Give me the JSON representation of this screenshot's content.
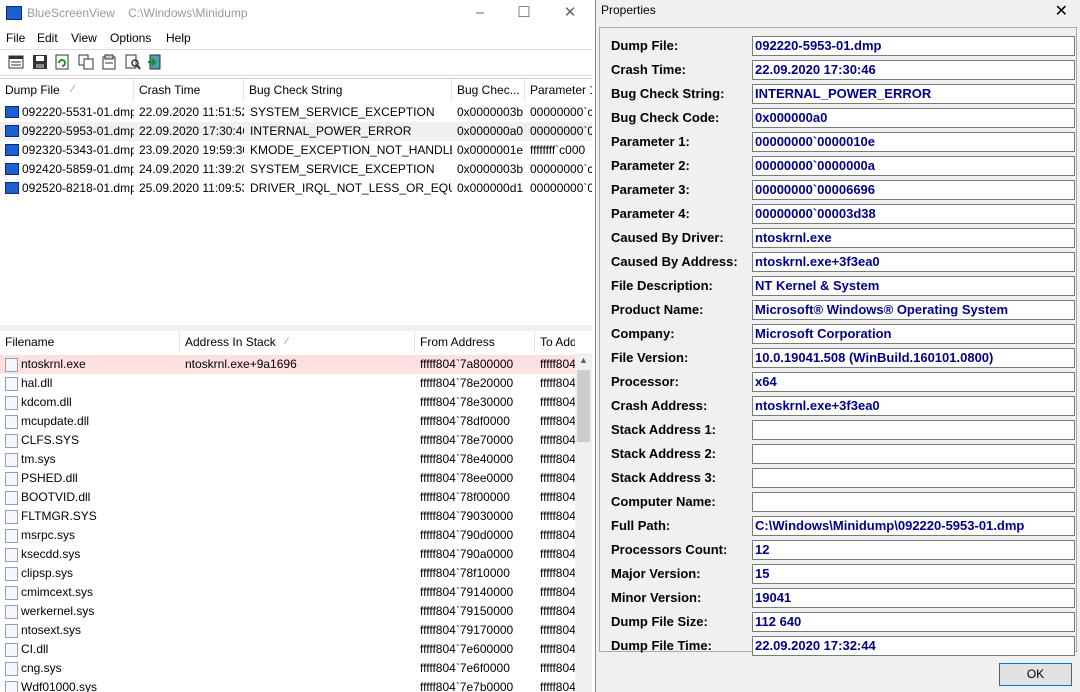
{
  "main_window": {
    "title": "BlueScreenView    C:\\Windows\\Minidump",
    "menu": [
      "File",
      "Edit",
      "View",
      "Options",
      "Help"
    ]
  },
  "dump_list": {
    "columns": [
      "Dump File",
      "Crash Time",
      "Bug Check String",
      "Bug Chec...",
      "Parameter 1"
    ],
    "rows": [
      [
        "092220-5531-01.dmp",
        "22.09.2020 11:51:52",
        "SYSTEM_SERVICE_EXCEPTION",
        "0x0000003b",
        "00000000`c0"
      ],
      [
        "092220-5953-01.dmp",
        "22.09.2020 17:30:46",
        "INTERNAL_POWER_ERROR",
        "0x000000a0",
        "00000000`00"
      ],
      [
        "092320-5343-01.dmp",
        "23.09.2020 19:59:30",
        "KMODE_EXCEPTION_NOT_HANDLED",
        "0x0000001e",
        "ffffffff`c000"
      ],
      [
        "092420-5859-01.dmp",
        "24.09.2020 11:39:20",
        "SYSTEM_SERVICE_EXCEPTION",
        "0x0000003b",
        "00000000`c0"
      ],
      [
        "092520-8218-01.dmp",
        "25.09.2020 11:09:53",
        "DRIVER_IRQL_NOT_LESS_OR_EQUAL",
        "0x000000d1",
        "00000000`00"
      ]
    ]
  },
  "driver_list": {
    "columns": [
      "Filename",
      "Address In Stack",
      "From Address",
      "To Add"
    ],
    "rows": [
      [
        "ntoskrnl.exe",
        "ntoskrnl.exe+9a1696",
        "fffff804`7a800000",
        "fffff804"
      ],
      [
        "hal.dll",
        "",
        "fffff804`78e20000",
        "fffff804"
      ],
      [
        "kdcom.dll",
        "",
        "fffff804`78e30000",
        "fffff804"
      ],
      [
        "mcupdate.dll",
        "",
        "fffff804`78df0000",
        "fffff804"
      ],
      [
        "CLFS.SYS",
        "",
        "fffff804`78e70000",
        "fffff804"
      ],
      [
        "tm.sys",
        "",
        "fffff804`78e40000",
        "fffff804"
      ],
      [
        "PSHED.dll",
        "",
        "fffff804`78ee0000",
        "fffff804"
      ],
      [
        "BOOTVID.dll",
        "",
        "fffff804`78f00000",
        "fffff804"
      ],
      [
        "FLTMGR.SYS",
        "",
        "fffff804`79030000",
        "fffff804"
      ],
      [
        "msrpc.sys",
        "",
        "fffff804`790d0000",
        "fffff804"
      ],
      [
        "ksecdd.sys",
        "",
        "fffff804`790a0000",
        "fffff804"
      ],
      [
        "clipsp.sys",
        "",
        "fffff804`78f10000",
        "fffff804"
      ],
      [
        "cmimcext.sys",
        "",
        "fffff804`79140000",
        "fffff804"
      ],
      [
        "werkernel.sys",
        "",
        "fffff804`79150000",
        "fffff804"
      ],
      [
        "ntosext.sys",
        "",
        "fffff804`79170000",
        "fffff804"
      ],
      [
        "CI.dll",
        "",
        "fffff804`7e600000",
        "fffff804"
      ],
      [
        "cng.sys",
        "",
        "fffff804`7e6f0000",
        "fffff804"
      ],
      [
        "Wdf01000.sys",
        "",
        "fffff804`7e7b0000",
        "fffff804"
      ]
    ]
  },
  "properties": {
    "title": "Properties",
    "ok_label": "OK",
    "fields": [
      {
        "label": "Dump File:",
        "value": "092220-5953-01.dmp"
      },
      {
        "label": "Crash Time:",
        "value": "22.09.2020 17:30:46"
      },
      {
        "label": "Bug Check String:",
        "value": "INTERNAL_POWER_ERROR"
      },
      {
        "label": "Bug Check Code:",
        "value": "0x000000a0"
      },
      {
        "label": "Parameter 1:",
        "value": "00000000`0000010e"
      },
      {
        "label": "Parameter 2:",
        "value": "00000000`0000000a"
      },
      {
        "label": "Parameter 3:",
        "value": "00000000`00006696"
      },
      {
        "label": "Parameter 4:",
        "value": "00000000`00003d38"
      },
      {
        "label": "Caused By Driver:",
        "value": "ntoskrnl.exe"
      },
      {
        "label": "Caused By Address:",
        "value": "ntoskrnl.exe+3f3ea0"
      },
      {
        "label": "File Description:",
        "value": "NT Kernel & System"
      },
      {
        "label": "Product Name:",
        "value": "Microsoft® Windows® Operating System"
      },
      {
        "label": "Company:",
        "value": "Microsoft Corporation"
      },
      {
        "label": "File Version:",
        "value": "10.0.19041.508 (WinBuild.160101.0800)"
      },
      {
        "label": "Processor:",
        "value": "x64"
      },
      {
        "label": "Crash Address:",
        "value": "ntoskrnl.exe+3f3ea0"
      },
      {
        "label": "Stack Address 1:",
        "value": ""
      },
      {
        "label": "Stack Address 2:",
        "value": ""
      },
      {
        "label": "Stack Address 3:",
        "value": ""
      },
      {
        "label": "Computer Name:",
        "value": ""
      },
      {
        "label": "Full Path:",
        "value": "C:\\Windows\\Minidump\\092220-5953-01.dmp"
      },
      {
        "label": "Processors Count:",
        "value": "12"
      },
      {
        "label": "Major Version:",
        "value": "15"
      },
      {
        "label": "Minor Version:",
        "value": "19041"
      },
      {
        "label": "Dump File Size:",
        "value": "112  640"
      },
      {
        "label": "Dump File Time:",
        "value": "22.09.2020 17:32:44"
      }
    ]
  },
  "colors": {
    "selected_row": "#f0f0f0",
    "highlight_row": "#fde0e0",
    "value_text": "#00008b"
  }
}
